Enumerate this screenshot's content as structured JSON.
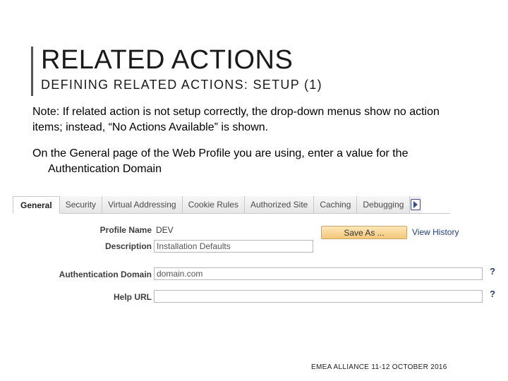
{
  "slide": {
    "title": "RELATED ACTIONS",
    "subtitle": "DEFINING RELATED ACTIONS: SETUP (1)",
    "note": "Note: If related action is not setup correctly, the drop-down menus show no action items; instead, “No Actions Available” is shown.",
    "step_line1": "On the General page of the Web Profile you are using, enter a value for the",
    "step_line2": "Authentication Domain",
    "footer": "EMEA ALLIANCE 11-12 OCTOBER 2016"
  },
  "tabs": [
    {
      "label": "General",
      "active": true
    },
    {
      "label": "Security"
    },
    {
      "label": "Virtual Addressing"
    },
    {
      "label": "Cookie Rules"
    },
    {
      "label": "Authorized Site"
    },
    {
      "label": "Caching"
    },
    {
      "label": "Debugging"
    }
  ],
  "form": {
    "profile_name_label": "Profile Name",
    "profile_name_value": "DEV",
    "description_label": "Description",
    "description_value": "Installation Defaults",
    "auth_domain_label": "Authentication Domain",
    "auth_domain_value": "domain.com",
    "help_url_label": "Help URL",
    "help_url_value": "",
    "save_as_label": "Save As ...",
    "view_history_label": "View History",
    "help_glyph": "?"
  },
  "colors": {
    "save_button": "#f4c879",
    "link": "#1d3f8b"
  }
}
